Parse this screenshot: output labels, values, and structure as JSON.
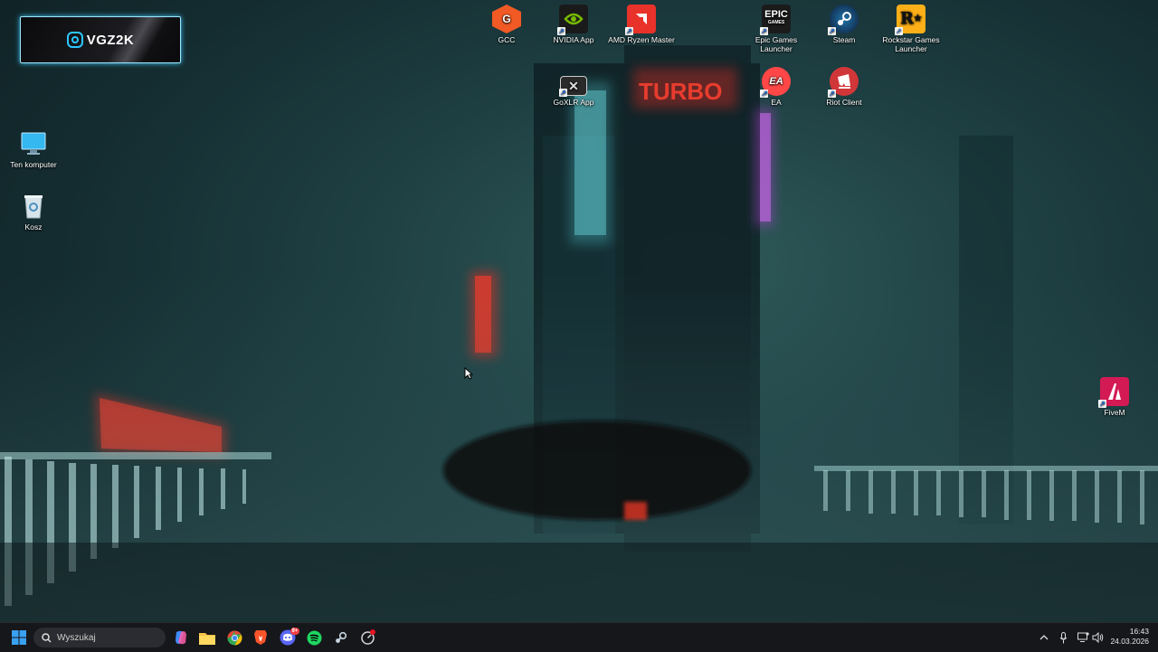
{
  "desktop": {
    "logo_text": "VGZ2K",
    "icons": {
      "gcc": "GCC",
      "nvidia": "NVIDIA App",
      "amd": "AMD Ryzen Master",
      "epic": "Epic Games Launcher",
      "steam": "Steam",
      "rockstar": "Rockstar Games Launcher",
      "goxlr": "GoXLR App",
      "ea": "EA",
      "riot": "Riot Client",
      "computer": "Ten komputer",
      "recycle": "Kosz",
      "fivem": "FiveM"
    },
    "wallpaper_signs": {
      "turbo_top": "TURBO"
    }
  },
  "taskbar": {
    "search_placeholder": "Wyszukaj",
    "clock_time": "16:43",
    "clock_date": "24.03.2026",
    "discord_badge": "9+"
  },
  "colors": {
    "taskbar_bg": "#16171b",
    "neon_red": "#ff2a1a",
    "neon_cyan": "#5ff4ff",
    "neon_magenta": "#e040ff"
  }
}
